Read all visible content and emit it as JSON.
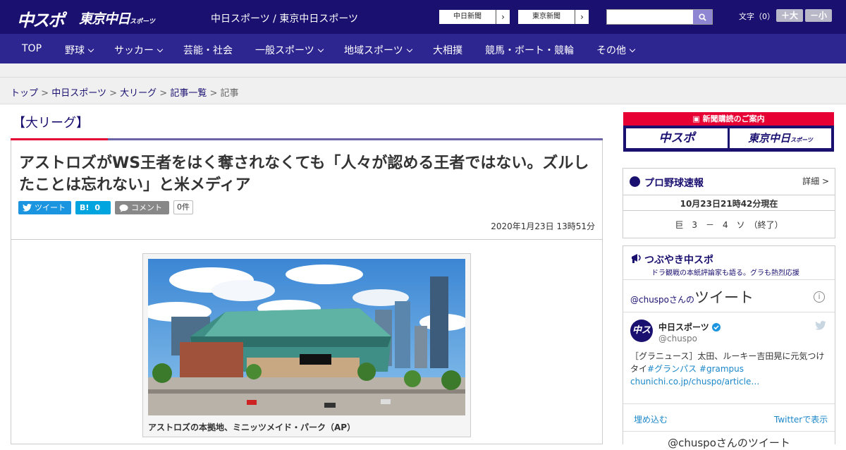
{
  "header": {
    "logo_chuspo": "中スポ",
    "logo_tokyo": "東京中日",
    "logo_tokyo_small": "スポーツ",
    "site_title": "中日スポーツ / 東京中日スポーツ",
    "links": [
      "中日新聞",
      "東京新聞"
    ],
    "search_placeholder": "",
    "font_size_label": "文字（0）",
    "font_plus": "＋大",
    "font_minus": "－小"
  },
  "nav": [
    {
      "label": "TOP",
      "dropdown": false
    },
    {
      "label": "野球",
      "dropdown": true
    },
    {
      "label": "サッカー",
      "dropdown": true
    },
    {
      "label": "芸能・社会",
      "dropdown": false
    },
    {
      "label": "一般スポーツ",
      "dropdown": true
    },
    {
      "label": "地域スポーツ",
      "dropdown": true
    },
    {
      "label": "大相撲",
      "dropdown": false
    },
    {
      "label": "競馬・ボート・競輪",
      "dropdown": false
    },
    {
      "label": "その他",
      "dropdown": true
    }
  ],
  "breadcrumb": {
    "items": [
      "トップ",
      "中日スポーツ",
      "大リーグ",
      "記事一覧"
    ],
    "current": "記事",
    "separator": ">"
  },
  "article": {
    "category": "【大リーグ】",
    "title": "アストロズがWS王者をはく奪されなくても「人々が認める王者ではない。ズルしたことは忘れない」と米メディア",
    "tweet_label": "ツイート",
    "hatena_label": "B!",
    "hatena_count": "0",
    "comment_label": "コメント",
    "comment_count": "0件",
    "date": "2020年1月23日 13時51分",
    "photo_caption": "アストロズの本拠地、ミニッツメイド・パーク（AP）"
  },
  "sidebar": {
    "subscribe_title": "新聞購読のご案内",
    "subscribe_chuspo": "中スポ",
    "subscribe_tokyo": "東京中日",
    "subscribe_tokyo_small": "スポーツ",
    "baseball_title": "プロ野球速報",
    "baseball_detail": "詳細 >",
    "baseball_time": "10月23日21時42分現在",
    "baseball_score": "巨　3　－　4　ソ　（終了）",
    "tsubuyaki_title": "つぶやき中スポ",
    "tsubuyaki_sub": "ドラ観戦の本紙評論家も語る。グラも熱烈応援",
    "tw_handle_head": "@chuspoさんの",
    "tw_head_big": "ツイート",
    "tw_info": "i",
    "tw_avatar": "中スポ",
    "tw_name": "中日スポーツ",
    "tw_handle": "@chuspo",
    "tw_text_1": "［グラニュース］太田、ルーキー吉田晃に元気つけタイ",
    "tw_hashtag_1": "#グランパス",
    "tw_hashtag_2": "#grampus",
    "tw_link": "chunichi.co.jp/chuspo/article…",
    "tw_embed": "埋め込む",
    "tw_view": "Twitterで表示",
    "tw_bottom": "@chuspoさんのツイート"
  },
  "colors": {
    "brand_navy": "#1a1070",
    "nav_purple": "#2d2590",
    "accent_red": "#e60033",
    "twitter_blue": "#1b87c9",
    "hatena_blue": "#00a4de"
  }
}
